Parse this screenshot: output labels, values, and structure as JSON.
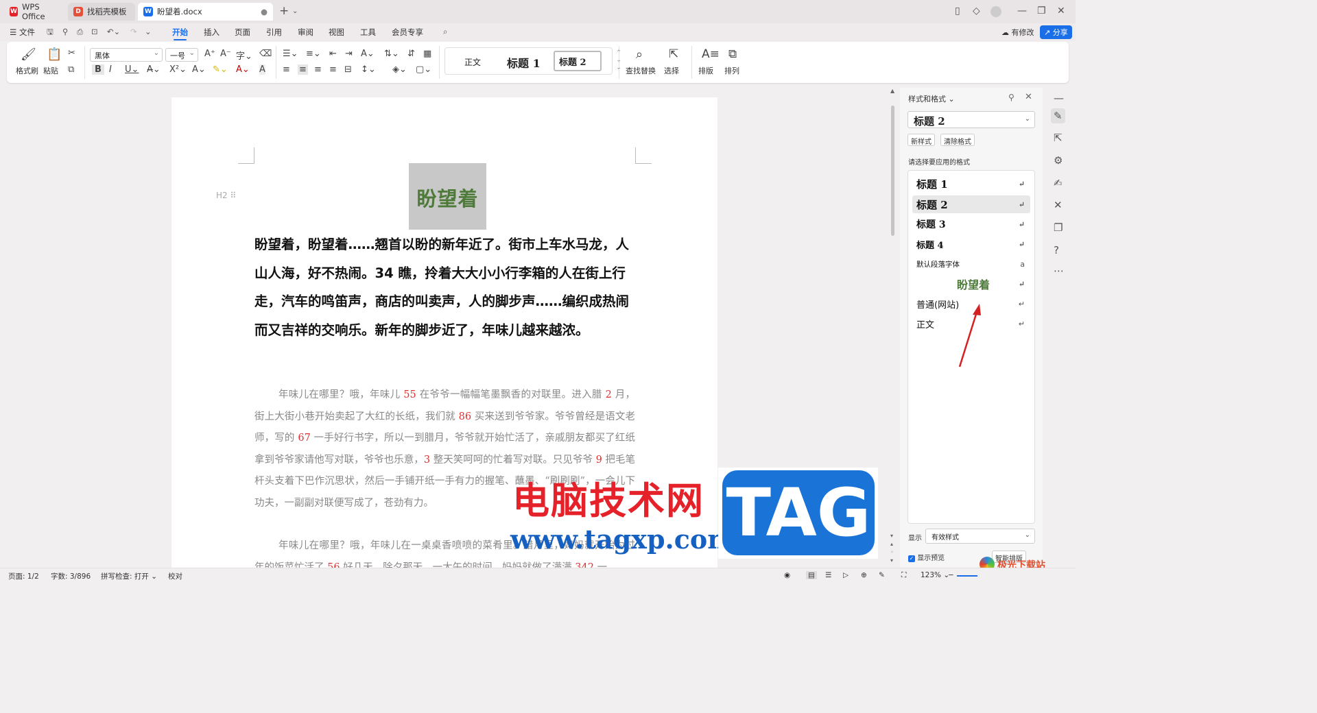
{
  "tabs": [
    {
      "label": "WPS Office",
      "icon": "wps-logo-icon",
      "color": "#e5222a"
    },
    {
      "label": "找稻壳模板",
      "icon": "template-icon",
      "color": "#e5503a"
    },
    {
      "label": "盼望着.docx",
      "icon": "word-doc-icon",
      "color": "#1a6ee8"
    }
  ],
  "menu": {
    "file": "文件",
    "items": [
      "开始",
      "插入",
      "页面",
      "引用",
      "审阅",
      "视图",
      "工具",
      "会员专享"
    ],
    "active": "开始",
    "changes": "有修改",
    "share": "分享"
  },
  "ribbon": {
    "format_painter": "格式刷",
    "paste": "粘贴",
    "font": "黑体",
    "font_size": "一号",
    "styles": [
      "正文",
      "标题 1",
      "标题 2"
    ],
    "find_replace": "查找替换",
    "select": "选择",
    "layout": "排版",
    "arrange": "排列"
  },
  "document": {
    "heading": "盼望着",
    "h2_mark": "H2",
    "bold_paragraph": "盼望着，盼望着……翘首以盼的新年近了。街市上车水马龙，人山人海，好不热闹。34 瞧，拎着大大小小行李箱的人在街上行走，汽车的鸣笛声，商店的叫卖声，人的脚步声……编织成热闹而又吉祥的交响乐。新年的脚步近了，年味儿越来越浓。",
    "para1": [
      {
        "t": "年味儿在哪里？哦，年味儿 "
      },
      {
        "t": "55",
        "red": true
      },
      {
        "t": " 在爷爷一幅幅笔墨飘香的对联里。进入腊 "
      },
      {
        "t": "2",
        "red": true
      },
      {
        "t": " 月，街上大街小巷开始卖起了大红的长纸，我们就 "
      },
      {
        "t": "86",
        "red": true
      },
      {
        "t": " 买来送到爷爷家。爷爷曾经是语文老师，写的 "
      },
      {
        "t": "67",
        "red": true
      },
      {
        "t": " 一手好行书字，所以一到腊月，爷爷就开始忙活了，亲戚朋友都买了红纸拿到爷爷家请他写对联，爷爷也乐意，"
      },
      {
        "t": "3",
        "red": true
      },
      {
        "t": " 整天笑呵呵的忙着写对联。只见爷爷 "
      },
      {
        "t": "9",
        "red": true
      },
      {
        "t": " 把毛笔杆头支着下巴作沉思状，然后一手铺开纸一手有力的握笔、蘸墨、“刷刷刷”，一会儿下功夫，一副副对联便写成了，苍劲有力。"
      }
    ],
    "para2": [
      {
        "t": "年味儿在哪里？哦，年味儿在一桌桌香喷喷的菜肴里。腊月里，妈妈就开始为过年的饭菜忙活了 "
      },
      {
        "t": "56",
        "red": true
      },
      {
        "t": " 好几天，除夕那天，一大午的时间，妈妈就做了满满 "
      },
      {
        "t": "342",
        "red": true
      },
      {
        "t": " 一"
      }
    ]
  },
  "panel": {
    "title": "样式和格式",
    "current_style": "标题 2",
    "new_style": "新样式",
    "clear_format": "清除格式",
    "prompt": "请选择要应用的格式",
    "styles": [
      "标题 1",
      "标题 2",
      "标题 3",
      "标题 4",
      "默认段落字体",
      "盼望着",
      "普通(网站)",
      "正文"
    ],
    "selected": "标题 2",
    "show_label": "显示",
    "show_value": "有效样式",
    "preview_label": "显示预览",
    "preview_checked": true,
    "smart_layout": "智能排版"
  },
  "status": {
    "page": "页面: 1/2",
    "words": "字数: 3/896",
    "spell": "拼写检查: 打开",
    "proof": "校对",
    "zoom": "123%"
  },
  "watermark": {
    "text": "电脑技术网",
    "url": "www.tagxp.com",
    "tag": "TAG",
    "site": "极光下载站"
  }
}
